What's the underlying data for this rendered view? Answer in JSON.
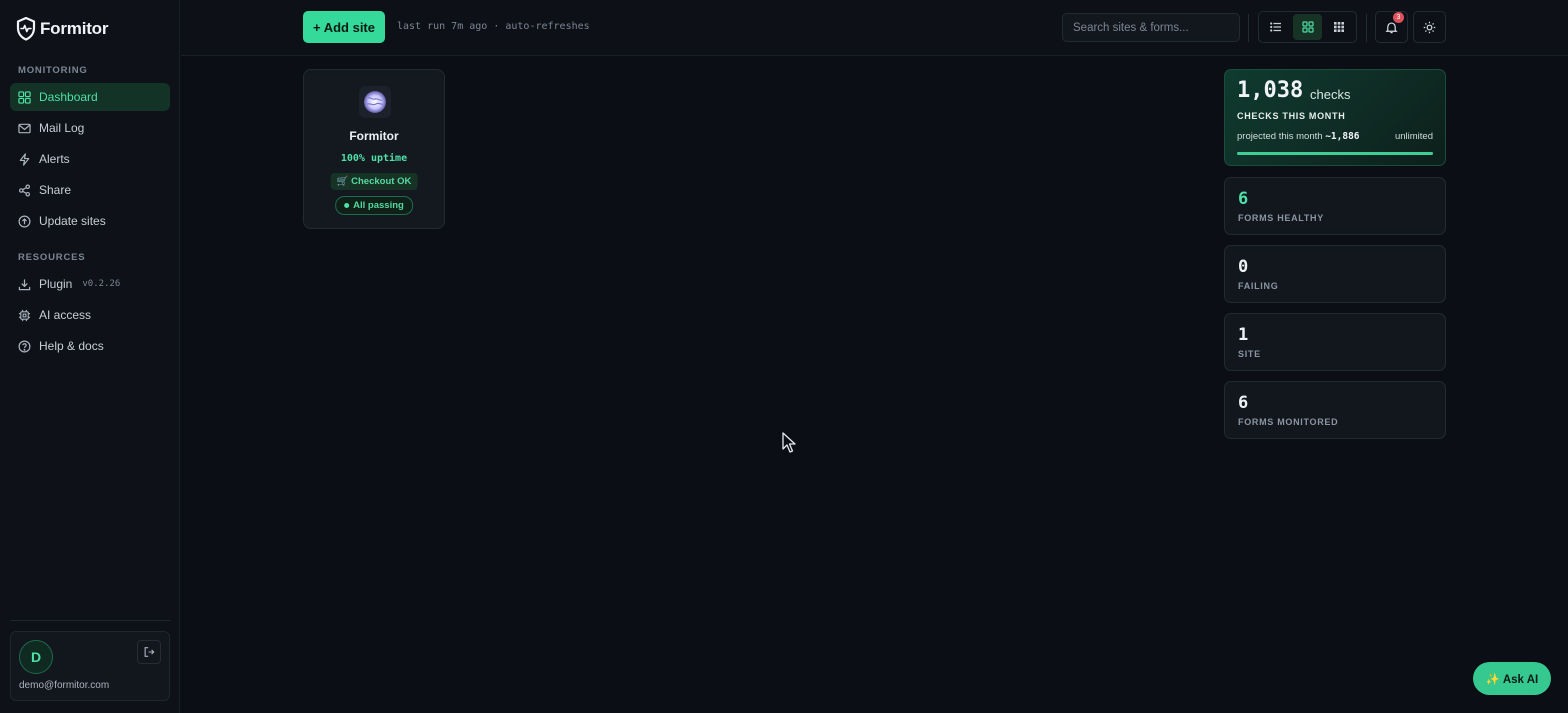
{
  "app": {
    "name": "Formitor"
  },
  "sidebar": {
    "monitoring_label": "MONITORING",
    "resources_label": "RESOURCES",
    "monitoring_items": [
      {
        "label": "Dashboard",
        "icon": "grid-icon",
        "active": true
      },
      {
        "label": "Mail Log",
        "icon": "mail-icon"
      },
      {
        "label": "Alerts",
        "icon": "bolt-icon"
      },
      {
        "label": "Share",
        "icon": "share-icon"
      },
      {
        "label": "Update sites",
        "icon": "upload-icon"
      }
    ],
    "resource_items": [
      {
        "label": "Plugin",
        "icon": "download-icon",
        "version": "v0.2.26"
      },
      {
        "label": "AI access",
        "icon": "chip-icon"
      },
      {
        "label": "Help & docs",
        "icon": "help-icon"
      }
    ],
    "user": {
      "initial": "D",
      "email": "demo@formitor.com"
    }
  },
  "topbar": {
    "add_site_label": "+ Add site",
    "last_run": "last run 7m ago · auto-refreshes",
    "search_placeholder": "Search sites & forms...",
    "notification_count": "3"
  },
  "site_card": {
    "name": "Formitor",
    "uptime": "100% uptime",
    "checkout": "🛒 Checkout OK",
    "status": "All passing"
  },
  "stats": {
    "hero": {
      "value": "1,038",
      "unit": "checks",
      "label": "CHECKS THIS MONTH",
      "projected_prefix": "projected this month ",
      "projected_value": "~1,886",
      "limit": "unlimited",
      "progress_percent": 100
    },
    "cards": [
      {
        "value": "6",
        "label": "FORMS HEALTHY",
        "accent": "#4fe0a6"
      },
      {
        "value": "0",
        "label": "FAILING"
      },
      {
        "value": "1",
        "label": "SITE"
      },
      {
        "value": "6",
        "label": "FORMS MONITORED"
      }
    ]
  },
  "ask_ai_label": "✨ Ask AI",
  "colors": {
    "accent": "#35d99a",
    "background": "#0b0f15",
    "badge": "#e0525b"
  }
}
